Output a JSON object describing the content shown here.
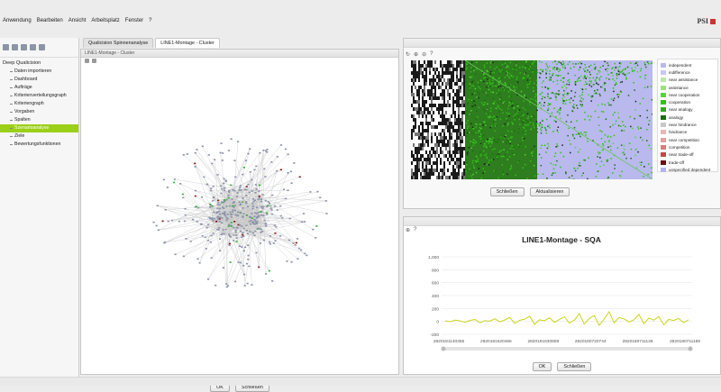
{
  "menu": [
    "Anwendung",
    "Bearbeiten",
    "Ansicht",
    "Arbeitsplatz",
    "Fenster",
    "?"
  ],
  "brand": "PSI",
  "tree": {
    "root": "Deep Qualicision",
    "items": [
      "Daten importieren",
      "Dashboard",
      "Aufträge",
      "Kriterienverteilungsgraph",
      "Kriteriengraph",
      "Vorgaben",
      "Spalten",
      "Szenarioanalyse",
      "Ziele",
      "Bewertungsfunktionen"
    ],
    "selected_index": 7
  },
  "tabs": [
    "Qualicision Spinnenanalyse",
    "LINE1-Montage - Cluster"
  ],
  "main": {
    "title": "LINE1-Montage - Cluster",
    "ok": "OK",
    "close": "Schließen"
  },
  "matrix": {
    "legend": [
      {
        "label": "independent",
        "color": "#b9b9ee"
      },
      {
        "label": "indifference",
        "color": "#c8c8f2"
      },
      {
        "label": "near assistance",
        "color": "#bce7a8"
      },
      {
        "label": "assistance",
        "color": "#9be27a"
      },
      {
        "label": "near cooperation",
        "color": "#54d43b"
      },
      {
        "label": "cooperation",
        "color": "#2ec414"
      },
      {
        "label": "near analogy",
        "color": "#33a81c"
      },
      {
        "label": "analogy",
        "color": "#1d6d12"
      },
      {
        "label": "near hindrance",
        "color": "#c9c9c9"
      },
      {
        "label": "hindrance",
        "color": "#e7b6b6"
      },
      {
        "label": "near competition",
        "color": "#e2a0a0"
      },
      {
        "label": "competition",
        "color": "#d67d7d"
      },
      {
        "label": "near trade-off",
        "color": "#c14a4a"
      },
      {
        "label": "trade-off",
        "color": "#6b1010"
      },
      {
        "label": "unspecified dependent",
        "color": "#b3b3ef"
      }
    ],
    "close": "Schließen",
    "refresh": "Aktualisieren"
  },
  "chart_data": {
    "type": "line",
    "title": "LINE1-Montage - SQA",
    "ylim": [
      -200,
      1000
    ],
    "yticks": [
      "1,000",
      "800",
      "600",
      "400",
      "200",
      "0",
      "-200"
    ],
    "xticks": [
      "2820181140355",
      "2820181520466",
      "2820181630808",
      "2820180720744",
      "2820180711126",
      "2820180711169"
    ],
    "series": [
      {
        "values": [
          10,
          -5,
          20,
          8,
          -12,
          15,
          30,
          -20,
          12,
          5,
          40,
          -8,
          22,
          60,
          -30,
          18,
          35,
          80,
          -45,
          25,
          10,
          55,
          -15,
          30,
          70,
          -25,
          20,
          120,
          -40,
          45,
          90,
          -60,
          35,
          150,
          -20,
          60,
          40,
          -10,
          25,
          110,
          -35,
          50,
          20,
          75,
          -50,
          30,
          15,
          45,
          -20,
          25
        ]
      }
    ],
    "color": "#c8d000"
  },
  "bottom": {
    "ok": "OK",
    "close": "Schließen"
  }
}
